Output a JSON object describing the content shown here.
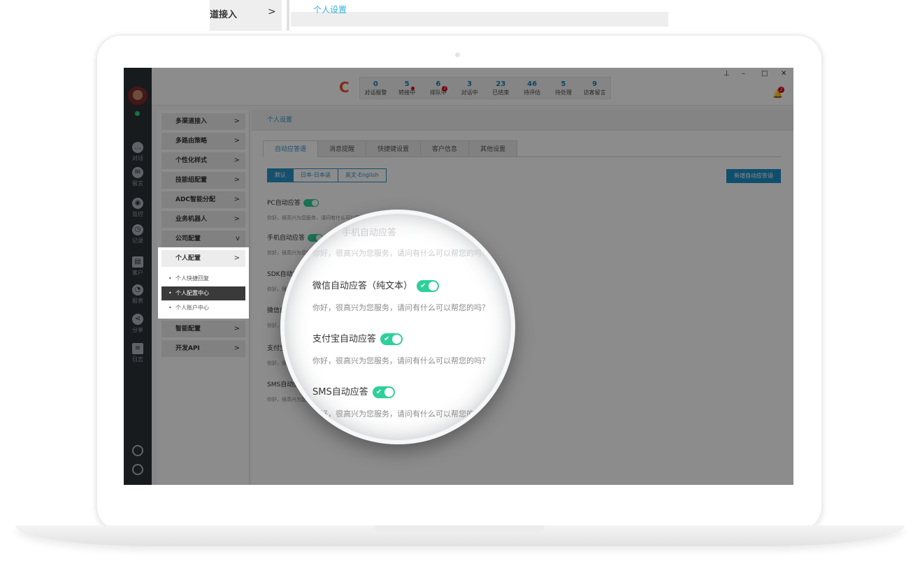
{
  "fragment": {
    "menu_text": "道接入",
    "chevron": ">",
    "link_text": "个人设置"
  },
  "app": {
    "stats": [
      {
        "value": "0",
        "label": "对话报警"
      },
      {
        "value": "5",
        "label": "转接中"
      },
      {
        "value": "6",
        "label": "排队中"
      },
      {
        "value": "3",
        "label": "对话中"
      },
      {
        "value": "23",
        "label": "已结束"
      },
      {
        "value": "46",
        "label": "待评估"
      },
      {
        "value": "5",
        "label": "待处理"
      },
      {
        "value": "9",
        "label": "访客留言"
      }
    ],
    "queue_badge": "2",
    "bell_badge": "2",
    "rail": [
      {
        "label": "对话",
        "icon": "chat-icon"
      },
      {
        "label": "留言",
        "icon": "mail-icon"
      },
      {
        "label": "监控",
        "icon": "eye-icon"
      },
      {
        "label": "记录",
        "icon": "clock-icon"
      },
      {
        "label": "客户",
        "icon": "contact-card-icon"
      },
      {
        "label": "报表",
        "icon": "pie-chart-icon"
      },
      {
        "label": "分享",
        "icon": "share-icon"
      },
      {
        "label": "日志",
        "icon": "clipboard-icon"
      }
    ],
    "menu": [
      "多渠道接入",
      "多路由策略",
      "个性化样式",
      "技能组配置",
      "ADC智能分配",
      "业务机器人",
      "公司配置",
      "个人配置",
      "智能配置",
      "开发API"
    ],
    "submenu": [
      "个人快捷回复",
      "个人配置中心",
      "个人账户中心"
    ],
    "breadcrumb": "个人设置",
    "tabs": [
      "自动应答语",
      "消息提醒",
      "快捷键设置",
      "客户信息",
      "其他设置"
    ],
    "languages": [
      "默认",
      "日本-日本语",
      "英文-English"
    ],
    "new_button": "新增自动应答语",
    "rows": [
      {
        "title": "PC自动应答",
        "sub": "你好，很高兴为您服务，请问有什么可以帮您的吗？"
      },
      {
        "title": "手机自动应答",
        "sub": "你好，很高兴为您服务，请问有什么可以帮您的吗？"
      },
      {
        "title": "SDK自动应答",
        "sub": "你好，很高兴为您服务，请问有什么可以帮您的吗？"
      },
      {
        "title": "微信自动应答（纯文本）",
        "sub": "你好，很高兴为您服务，请问有什么可以帮您的吗？"
      },
      {
        "title": "支付宝自动应答",
        "sub": "你好，很高兴为您服务，请问有什么可以帮您的吗？"
      },
      {
        "title": "SMS自动应答",
        "sub": "你好，很高兴为您服务，请问有什么可以帮您的吗？"
      }
    ],
    "window_controls": {
      "pin": "⊥",
      "minimize": "–",
      "maximize": "□",
      "close": "✕"
    }
  },
  "colors": {
    "accent": "#2a93c6",
    "toggle_on": "#2ed09a",
    "badge": "#d0021b",
    "rail": "#2c3238"
  }
}
